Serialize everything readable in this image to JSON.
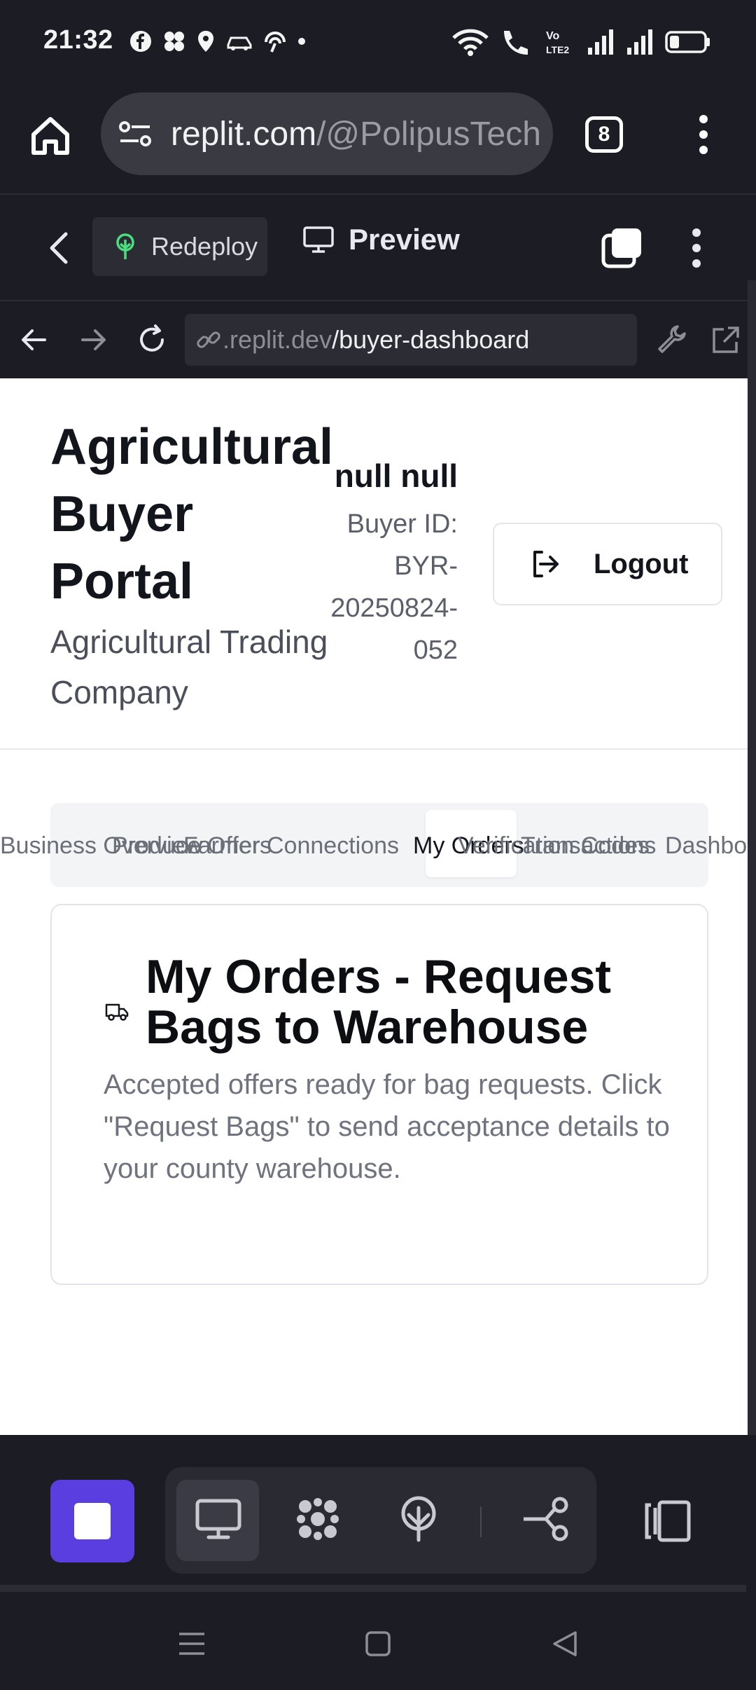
{
  "status_bar": {
    "time": "21:32"
  },
  "browser": {
    "url_host": "replit.com",
    "url_path": "/@PolipusTech",
    "tab_count": "8"
  },
  "replit_toolbar": {
    "redeploy_label": "Redeploy",
    "preview_label": "Preview"
  },
  "webview": {
    "url_dim": ".replit.dev",
    "url_path": "/buyer-dashboard"
  },
  "portal": {
    "title": "Agricultural Buyer Portal",
    "company": "Agricultural Trading Company",
    "user_name": "null null",
    "buyer_id": "Buyer ID: BYR-20250824-052",
    "logout_label": "Logout"
  },
  "tabs": [
    {
      "label": "Business Overview"
    },
    {
      "label": "Produce Offers"
    },
    {
      "label": "Farmer Connections"
    },
    {
      "label": "My Orders"
    },
    {
      "label": "Transactions"
    },
    {
      "label": "Verification Codes"
    },
    {
      "label": "Dashboard"
    }
  ],
  "active_tab": "My Orders",
  "orders_card": {
    "title": "My Orders - Request Bags to Warehouse",
    "description": "Accepted offers ready for bag requests. Click \"Request Bags\" to send acceptance details to your county warehouse."
  },
  "colors": {
    "brand_purple": "#5b3ee0",
    "chrome_dark": "#1c1d24",
    "redeploy_green": "#4ade80"
  }
}
